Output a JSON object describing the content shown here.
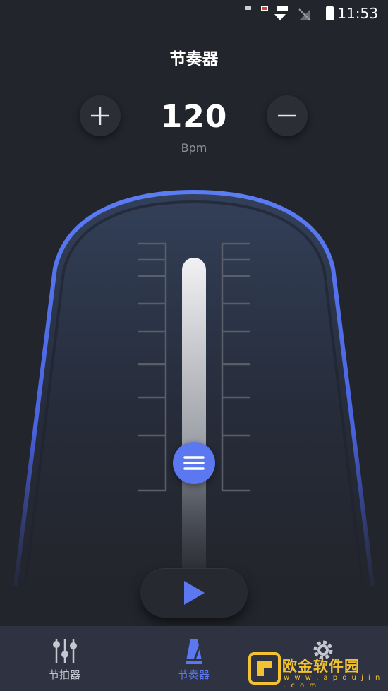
{
  "status_bar": {
    "time": "11:53"
  },
  "header": {
    "title": "节奏器"
  },
  "tempo": {
    "value": "120",
    "unit": "Bpm"
  },
  "tempo_level": 0.5,
  "tab_bar": {
    "tabs": [
      {
        "label": "节拍器",
        "icon": "sliders-icon",
        "active": false
      },
      {
        "label": "节奏器",
        "icon": "metronome-icon",
        "active": true
      },
      {
        "label": "",
        "icon": "gear-icon",
        "active": false
      }
    ]
  },
  "watermark": {
    "text": "欧金软件园",
    "url": "w w w . a p o u j i n . c o m"
  },
  "colors": {
    "accent": "#5b78f0",
    "background": "#23252c",
    "tab_bar": "#2f3240",
    "watermark": "#f2c230"
  }
}
